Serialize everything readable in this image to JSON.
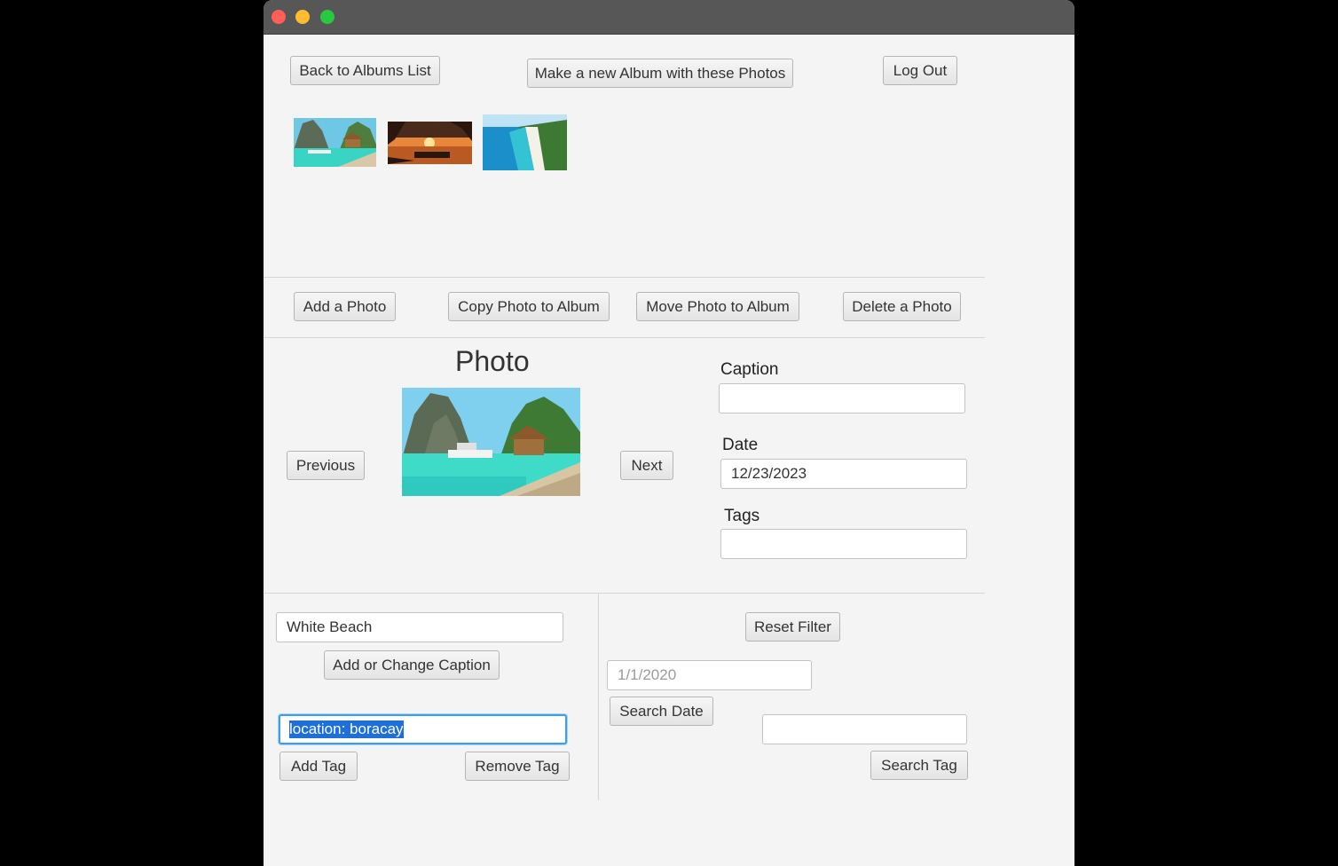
{
  "window": {
    "controls": {
      "close": "close",
      "minimize": "minimize",
      "zoom": "zoom"
    }
  },
  "toolbar": {
    "back_label": "Back to Albums List",
    "new_album_label": "Make a new Album with these Photos",
    "logout_label": "Log Out"
  },
  "thumbnails": [
    {
      "name": "lagoon-with-hut",
      "icon": "photo-thumbnail-icon"
    },
    {
      "name": "sunset-beach",
      "icon": "photo-thumbnail-icon"
    },
    {
      "name": "aerial-white-beach",
      "icon": "photo-thumbnail-icon"
    }
  ],
  "photo_actions": {
    "add_label": "Add a Photo",
    "copy_label": "Copy Photo to Album",
    "move_label": "Move Photo to Album",
    "delete_label": "Delete a Photo"
  },
  "viewer": {
    "title": "Photo",
    "previous_label": "Previous",
    "next_label": "Next"
  },
  "details": {
    "caption_label": "Caption",
    "caption_value": "",
    "date_label": "Date",
    "date_value": "12/23/2023",
    "tags_label": "Tags",
    "tags_value": ""
  },
  "editing": {
    "caption_input_value": "White Beach",
    "caption_button_label": "Add or Change Caption",
    "tag_input_value": "location: boracay",
    "add_tag_label": "Add Tag",
    "remove_tag_label": "Remove Tag"
  },
  "search": {
    "reset_label": "Reset Filter",
    "date_placeholder": "1/1/2020",
    "search_date_label": "Search Date",
    "tag_input_value": "",
    "search_tag_label": "Search Tag"
  },
  "colors": {
    "window_bg": "#f4f4f4",
    "titlebar": "#575757",
    "focus_ring": "#3b9ff1",
    "selection": "#1e6fd9"
  }
}
